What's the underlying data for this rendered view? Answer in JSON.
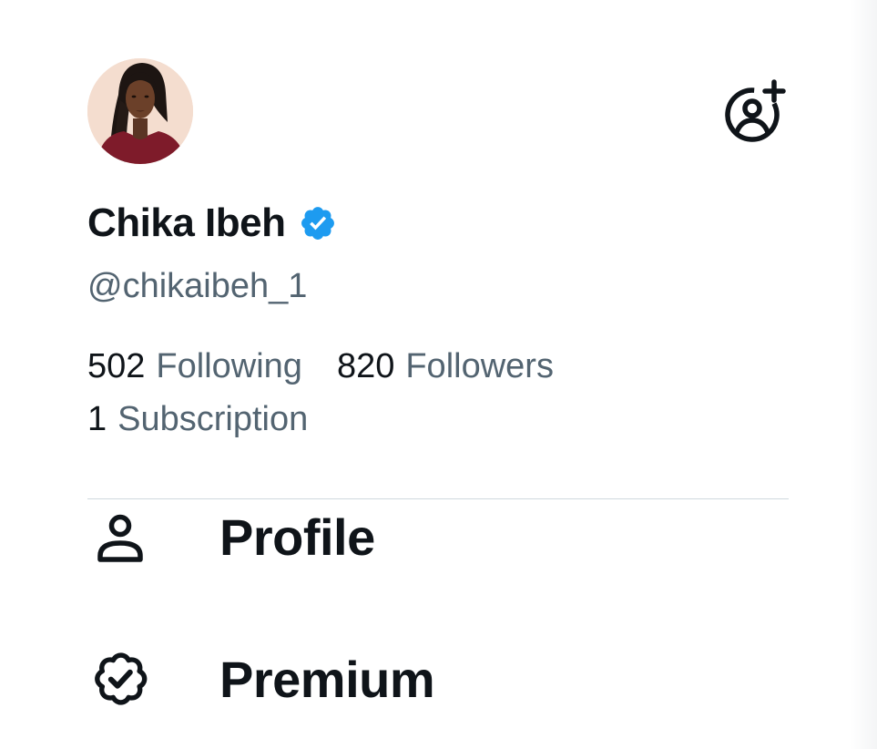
{
  "account": {
    "display_name": "Chika Ibeh",
    "handle": "@chikaibeh_1",
    "verified": true,
    "badge_color": "#1d9bf0"
  },
  "stats": {
    "following_count": "502",
    "following_label": "Following",
    "followers_count": "820",
    "followers_label": "Followers",
    "subscriptions_count": "1",
    "subscriptions_label": "Subscription"
  },
  "menu": {
    "items": [
      {
        "label": "Profile",
        "icon": "person-icon"
      },
      {
        "label": "Premium",
        "icon": "premium-badge-icon"
      }
    ]
  },
  "header": {
    "add_account_icon": "add-account-icon"
  },
  "colors": {
    "text_primary": "#0f1419",
    "text_secondary": "#536471",
    "divider": "#cfd9de",
    "background": "#ffffff"
  }
}
